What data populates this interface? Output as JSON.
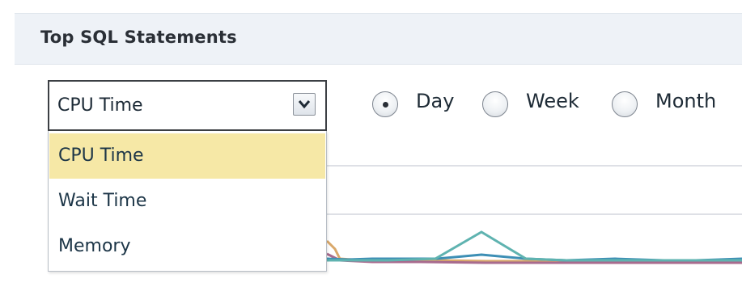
{
  "panel": {
    "title": "Top SQL Statements"
  },
  "metric_select": {
    "value": "CPU Time",
    "options": [
      "CPU Time",
      "Wait Time",
      "Memory"
    ],
    "highlighted": "CPU Time"
  },
  "period": {
    "options": [
      "Day",
      "Week",
      "Month"
    ],
    "selected": "Day"
  },
  "chart_data": {
    "type": "line",
    "series": [
      {
        "color": "#5fb3b0"
      },
      {
        "color": "#3d8fb5"
      },
      {
        "color": "#d9a86a"
      },
      {
        "color": "#a86b8e"
      }
    ]
  }
}
